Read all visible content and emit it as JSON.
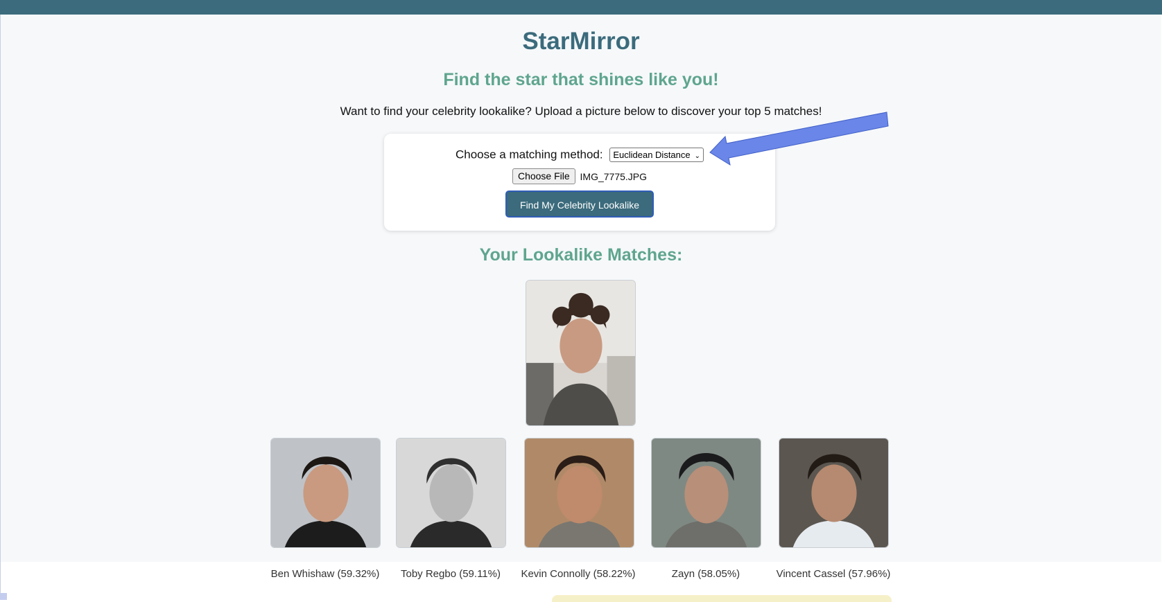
{
  "app": {
    "title": "StarMirror",
    "tagline": "Find the star that shines like you!",
    "intro": "Want to find your celebrity lookalike? Upload a picture below to discover your top 5 matches!"
  },
  "form": {
    "method_label": "Choose a matching method:",
    "method_selected": "Euclidean Distance",
    "choose_file_label": "Choose File",
    "file_name": "IMG_7775.JPG",
    "submit_label": "Find My Celebrity Lookalike"
  },
  "results": {
    "title": "Your Lookalike Matches:",
    "matches": [
      {
        "label": "Ben Whishaw (59.32%)",
        "name": "Ben Whishaw",
        "similarity_percent": 59.32
      },
      {
        "label": "Toby Regbo (59.11%)",
        "name": "Toby Regbo",
        "similarity_percent": 59.11
      },
      {
        "label": "Kevin Connolly (58.22%)",
        "name": "Kevin Connolly",
        "similarity_percent": 58.22
      },
      {
        "label": "Zayn (58.05%)",
        "name": "Zayn",
        "similarity_percent": 58.05
      },
      {
        "label": "Vincent Cassel (57.96%)",
        "name": "Vincent Cassel",
        "similarity_percent": 57.96
      }
    ]
  },
  "colors": {
    "brand": "#3b6b7c",
    "accent_green": "#5fa58e",
    "annotation_arrow": "#6a86e8"
  },
  "icons": {
    "select_chevron": "chevron-down-icon",
    "annotation": "arrow-pointer-icon"
  }
}
